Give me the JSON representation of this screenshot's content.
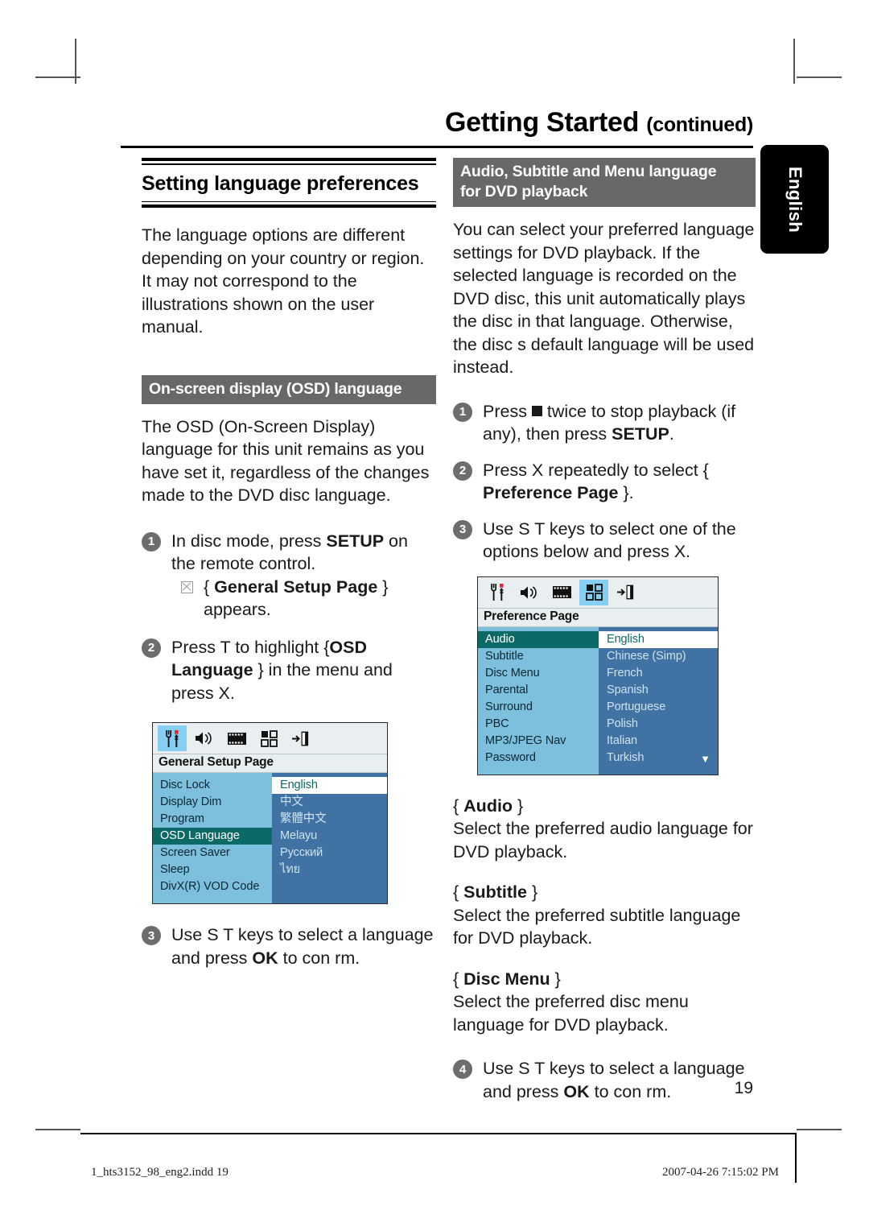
{
  "header": {
    "title": "Getting Started",
    "continued": "(continued)",
    "side_tab": "English",
    "page_number": "19"
  },
  "left_column": {
    "section_title": "Setting language preferences",
    "intro": "The language options are different depending on your country or region. It may not correspond to the illustrations shown on the user manual.",
    "osd_heading": "On-screen display (OSD) language",
    "osd_paragraph": "The OSD (On-Screen Display) language for this unit remains as you have set it, regardless of the changes made to the DVD disc language.",
    "steps": [
      {
        "num": "1",
        "text_a": "In disc mode, press ",
        "bold_a": "SETUP",
        "text_b": " on the remote control.",
        "sub": {
          "pre": "{ ",
          "bold": "General Setup Page",
          "post": " } appears."
        }
      },
      {
        "num": "2",
        "text_a": "Press T to highlight {",
        "bold_a": "OSD Language",
        "text_b": " } in the menu and press X."
      },
      {
        "num": "3",
        "text_a": "Use S T keys to select a language and press ",
        "bold_a": "OK",
        "text_b": " to con rm."
      }
    ],
    "osd_screen": {
      "page_title": "General Setup Page",
      "icons": [
        "setup-tools-icon",
        "speaker-icon",
        "film-strip-icon",
        "grid-squares-icon",
        "exit-door-icon"
      ],
      "selected_icon_index": 0,
      "menu_items": [
        "Disc Lock",
        "Display Dim",
        "Program",
        "OSD Language",
        "Screen Saver",
        "Sleep",
        "DivX(R) VOD Code"
      ],
      "highlighted_item": "OSD Language",
      "options": [
        "English",
        "中文",
        "繁體中文",
        "Melayu",
        "Русский",
        "ไทย"
      ],
      "selected_option": "English",
      "has_scroll_caret": false
    }
  },
  "right_column": {
    "heading_line1": "Audio, Subtitle and Menu language",
    "heading_line2": "for DVD playback",
    "intro": "You can select your preferred language settings for DVD playback. If the selected language is recorded on the DVD disc, this unit automatically plays the disc in that language. Otherwise, the disc s default language will be used instead.",
    "steps": [
      {
        "num": "1",
        "text_a": "Press ",
        "icon": "stop-square-icon",
        "text_b": " twice to stop playback (if any), then press ",
        "bold_a": "SETUP",
        "text_c": "."
      },
      {
        "num": "2",
        "text_a": "Press X repeatedly to select { ",
        "bold_a": "Preference Page",
        "text_b": " }."
      },
      {
        "num": "3",
        "text_a": "Use S T keys to select one of the options below and press X."
      }
    ],
    "osd_screen": {
      "page_title": "Preference Page",
      "icons": [
        "setup-tools-icon",
        "speaker-icon",
        "film-strip-icon",
        "grid-squares-icon",
        "exit-door-icon"
      ],
      "selected_icon_index": 3,
      "menu_items": [
        "Audio",
        "Subtitle",
        "Disc Menu",
        "Parental",
        "Surround",
        "PBC",
        "MP3/JPEG Nav",
        "Password"
      ],
      "highlighted_item": "Audio",
      "options": [
        "English",
        "Chinese (Simp)",
        "French",
        "Spanish",
        "Portuguese",
        "Polish",
        "Italian",
        "Turkish"
      ],
      "selected_option": "English",
      "has_scroll_caret": true,
      "scroll_caret": "▼"
    },
    "options_doc": [
      {
        "label_pre": "{ ",
        "label_bold": "Audio",
        "label_post": " }",
        "body": "Select the preferred audio language for DVD playback."
      },
      {
        "label_pre": "{ ",
        "label_bold": "Subtitle",
        "label_post": " }",
        "body": "Select the preferred subtitle language for DVD playback."
      },
      {
        "label_pre": "{ ",
        "label_bold": "Disc Menu",
        "label_post": " }",
        "body": "Select the preferred disc menu language for DVD playback."
      }
    ],
    "final_step": {
      "num": "4",
      "text_a": "Use S T keys to select a language and press ",
      "bold_a": "OK",
      "text_b": " to con rm."
    }
  },
  "footer": {
    "file_name": "1_hts3152_98_eng2.indd   19",
    "timestamp": "2007-04-26   7:15:02 PM"
  },
  "colors": {
    "grey_heading": "#686868",
    "osd_panel_light": "#7cc0dd",
    "osd_panel_dark": "#4073a4",
    "osd_highlight": "#0c6a66",
    "osd_titlebar": "#e9eff1",
    "icon_selected": "#86cff2"
  }
}
